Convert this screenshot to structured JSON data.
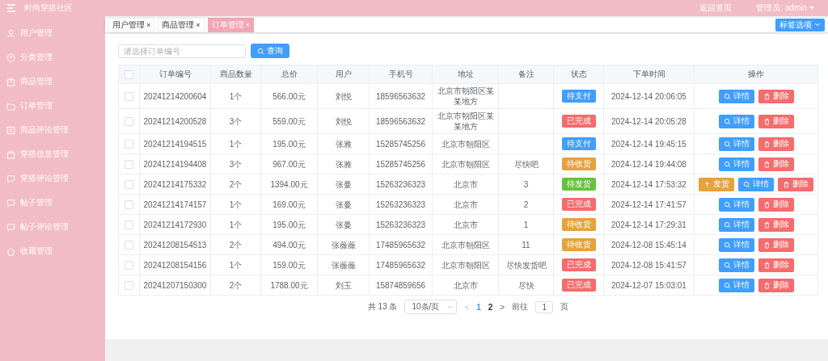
{
  "header": {
    "title": "时尚穿搭社区",
    "links": [
      "返回首页"
    ],
    "user": "管理员: admin"
  },
  "sidebar": {
    "items": [
      {
        "label": "用户管理"
      },
      {
        "label": "分类管理"
      },
      {
        "label": "商品管理"
      },
      {
        "label": "订单管理"
      },
      {
        "label": "商品评论管理"
      },
      {
        "label": "穿搭信息管理"
      },
      {
        "label": "穿搭评论管理"
      },
      {
        "label": "帖子管理"
      },
      {
        "label": "帖子评论管理"
      },
      {
        "label": "收藏管理"
      }
    ]
  },
  "tabs": [
    {
      "label": "用户管理",
      "close": "×",
      "selected": false
    },
    {
      "label": "商品管理",
      "close": "×",
      "selected": false
    },
    {
      "label": "订单管理",
      "close": "×",
      "selected": true
    }
  ],
  "tab_options": "标签选项",
  "search": {
    "placeholder": "请选择订单编号",
    "button": "查询"
  },
  "table": {
    "select_all": {
      "checked": false
    },
    "columns": [
      "订单编号",
      "商品数量",
      "总价",
      "用户",
      "手机号",
      "地址",
      "备注",
      "状态",
      "下单时间",
      "操作"
    ],
    "rows": [
      {
        "checked": false,
        "id": "20241214200604",
        "qty": "1个",
        "total": "566.00元",
        "user": "刘悦",
        "phone": "18596563632",
        "address": "北京市朝阳区某某地方",
        "remark": "",
        "status": {
          "label": "待支付",
          "color": "#409eff"
        },
        "time": "2024-12-14 20:06:05",
        "actions": [
          {
            "kind": "detail",
            "label": "详情"
          },
          {
            "kind": "delete",
            "label": "删除"
          }
        ]
      },
      {
        "checked": false,
        "id": "20241214200528",
        "qty": "3个",
        "total": "559.00元",
        "user": "刘悦",
        "phone": "18596563632",
        "address": "北京市朝阳区某某地方",
        "remark": "",
        "status": {
          "label": "已完成",
          "color": "#f56c6c"
        },
        "time": "2024-12-14 20:05:28",
        "actions": [
          {
            "kind": "detail",
            "label": "详情"
          },
          {
            "kind": "delete",
            "label": "删除"
          }
        ]
      },
      {
        "checked": false,
        "id": "20241214194515",
        "qty": "1个",
        "total": "195.00元",
        "user": "张雅",
        "phone": "15285745256",
        "address": "北京市朝阳区",
        "remark": "",
        "status": {
          "label": "待支付",
          "color": "#409eff"
        },
        "time": "2024-12-14 19:45:15",
        "actions": [
          {
            "kind": "detail",
            "label": "详情"
          },
          {
            "kind": "delete",
            "label": "删除"
          }
        ]
      },
      {
        "checked": false,
        "id": "20241214194408",
        "qty": "3个",
        "total": "967.00元",
        "user": "张雅",
        "phone": "15285745256",
        "address": "北京市朝阳区",
        "remark": "尽快吧",
        "status": {
          "label": "待收货",
          "color": "#e6a23c"
        },
        "time": "2024-12-14 19:44:08",
        "actions": [
          {
            "kind": "detail",
            "label": "详情"
          },
          {
            "kind": "delete",
            "label": "删除"
          }
        ]
      },
      {
        "checked": false,
        "id": "20241214175332",
        "qty": "2个",
        "total": "1394.00元",
        "user": "张曼",
        "phone": "15263236323",
        "address": "北京市",
        "remark": "3",
        "status": {
          "label": "待发货",
          "color": "#67c23a"
        },
        "time": "2024-12-14 17:53:32",
        "actions": [
          {
            "kind": "ship",
            "label": "发货"
          },
          {
            "kind": "detail",
            "label": "详情"
          },
          {
            "kind": "delete",
            "label": "删除"
          }
        ]
      },
      {
        "checked": false,
        "id": "20241214174157",
        "qty": "1个",
        "total": "169.00元",
        "user": "张曼",
        "phone": "15263236323",
        "address": "北京市",
        "remark": "2",
        "status": {
          "label": "已完成",
          "color": "#f56c6c"
        },
        "time": "2024-12-14 17:41:57",
        "actions": [
          {
            "kind": "detail",
            "label": "详情"
          },
          {
            "kind": "delete",
            "label": "删除"
          }
        ]
      },
      {
        "checked": false,
        "id": "20241214172930",
        "qty": "1个",
        "total": "195.00元",
        "user": "张曼",
        "phone": "15263236323",
        "address": "北京市",
        "remark": "1",
        "status": {
          "label": "待收货",
          "color": "#e6a23c"
        },
        "time": "2024-12-14 17:29:31",
        "actions": [
          {
            "kind": "detail",
            "label": "详情"
          },
          {
            "kind": "delete",
            "label": "删除"
          }
        ]
      },
      {
        "checked": false,
        "id": "20241208154513",
        "qty": "2个",
        "total": "494.00元",
        "user": "张薇薇",
        "phone": "17485965632",
        "address": "北京市朝阳区",
        "remark": "11",
        "status": {
          "label": "待收货",
          "color": "#e6a23c"
        },
        "time": "2024-12-08 15:45:14",
        "actions": [
          {
            "kind": "detail",
            "label": "详情"
          },
          {
            "kind": "delete",
            "label": "删除"
          }
        ]
      },
      {
        "checked": false,
        "id": "20241208154156",
        "qty": "1个",
        "total": "159.00元",
        "user": "张薇薇",
        "phone": "17485965632",
        "address": "北京市朝阳区",
        "remark": "尽快发货吧",
        "status": {
          "label": "已完成",
          "color": "#f56c6c"
        },
        "time": "2024-12-08 15:41:57",
        "actions": [
          {
            "kind": "detail",
            "label": "详情"
          },
          {
            "kind": "delete",
            "label": "删除"
          }
        ]
      },
      {
        "checked": false,
        "id": "20241207150300",
        "qty": "2个",
        "total": "1788.00元",
        "user": "刘玉",
        "phone": "15874859656",
        "address": "北京市",
        "remark": "尽快",
        "status": {
          "label": "已完成",
          "color": "#f56c6c"
        },
        "time": "2024-12-07 15:03:01",
        "actions": [
          {
            "kind": "detail",
            "label": "详情"
          },
          {
            "kind": "delete",
            "label": "删除"
          }
        ]
      }
    ]
  },
  "pagination": {
    "total": "共 13 条",
    "page_size": "10条/页",
    "prev": "<",
    "pages": [
      {
        "label": "1",
        "selected": true
      },
      {
        "label": "2",
        "selected": false
      }
    ],
    "next": ">",
    "goto": "前往",
    "goto_value": "1",
    "goto_suffix": "页"
  }
}
